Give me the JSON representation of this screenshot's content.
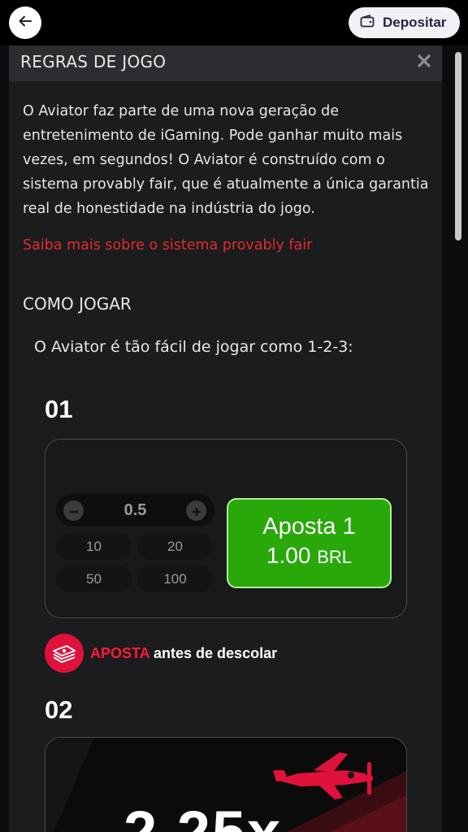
{
  "topbar": {
    "back_icon": "arrow-left-icon",
    "deposit_label": "Depositar",
    "deposit_icon": "wallet-icon"
  },
  "modal": {
    "title": "REGRAS DE JOGO",
    "close_icon": "close-icon",
    "intro": "O Aviator faz parte de uma nova geração de entretenimento de iGaming. Pode ganhar muito mais vezes, em segundos! O Aviator é construído com o sistema provably fair, que é atualmente a única garantia real de honestidade na indústria do jogo.",
    "link": "Saiba mais sobre o sistema provably fair",
    "section_title": "COMO JOGAR",
    "how_text": "O Aviator é tão fácil de jogar como 1-2-3:",
    "step1": {
      "number": "01",
      "stepper_value": "0.5",
      "chips": [
        "10",
        "20",
        "50",
        "100"
      ],
      "bet_line1": "Aposta 1",
      "bet_amount": "1.00",
      "bet_currency": "BRL",
      "caption_highlight": "APOSTA",
      "caption_rest": " antes de descolar",
      "caption_icon": "money-icon"
    },
    "step2": {
      "number": "02",
      "multiplier": "2.25x",
      "plane_icon": "plane-icon"
    }
  },
  "colors": {
    "accent_red": "#e12b2b",
    "bet_green": "#28a909",
    "modal_bg": "#1b1c1d",
    "header_bg": "#2c2d30"
  }
}
